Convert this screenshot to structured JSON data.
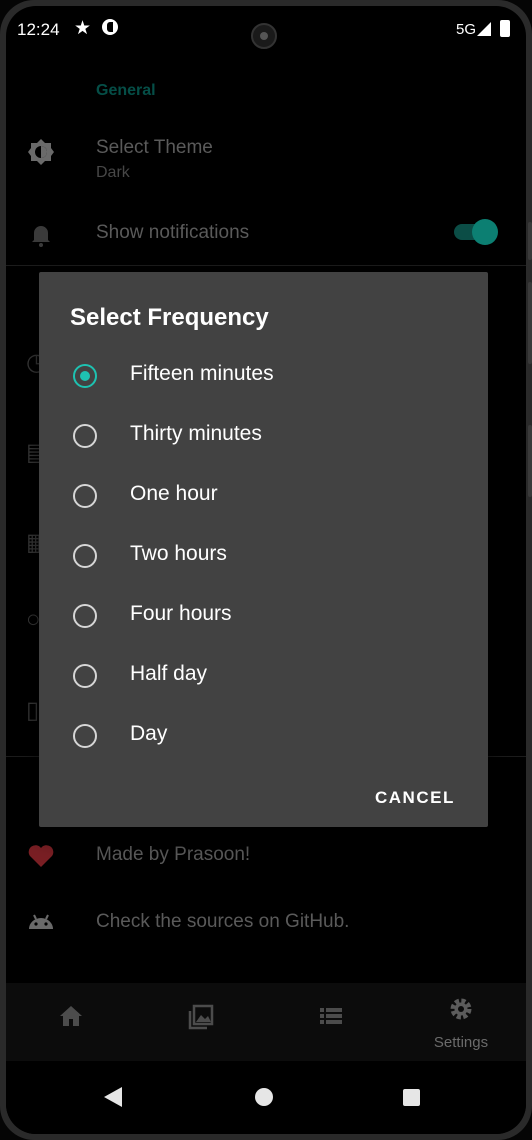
{
  "status_bar": {
    "time": "12:24",
    "network": "5G"
  },
  "settings": {
    "section_general": "General",
    "theme_title": "Select Theme",
    "theme_value": "Dark",
    "notifications_title": "Show notifications",
    "notifications_enabled": true,
    "made_by": "Made by Prasoon!",
    "github": "Check the sources on GitHub."
  },
  "dialog": {
    "title": "Select Frequency",
    "options": [
      {
        "label": "Fifteen minutes",
        "selected": true
      },
      {
        "label": "Thirty minutes",
        "selected": false
      },
      {
        "label": "One hour",
        "selected": false
      },
      {
        "label": "Two hours",
        "selected": false
      },
      {
        "label": "Four hours",
        "selected": false
      },
      {
        "label": "Half day",
        "selected": false
      },
      {
        "label": "Day",
        "selected": false
      }
    ],
    "cancel_label": "CANCEL"
  },
  "bottom_nav": {
    "items": [
      {
        "icon": "home-icon",
        "label": ""
      },
      {
        "icon": "gallery-icon",
        "label": ""
      },
      {
        "icon": "list-icon",
        "label": ""
      },
      {
        "icon": "gear-icon",
        "label": "Settings"
      }
    ]
  },
  "colors": {
    "accent": "#1ec2b1",
    "dialog_bg": "#424242",
    "heart": "#7a1f24"
  }
}
